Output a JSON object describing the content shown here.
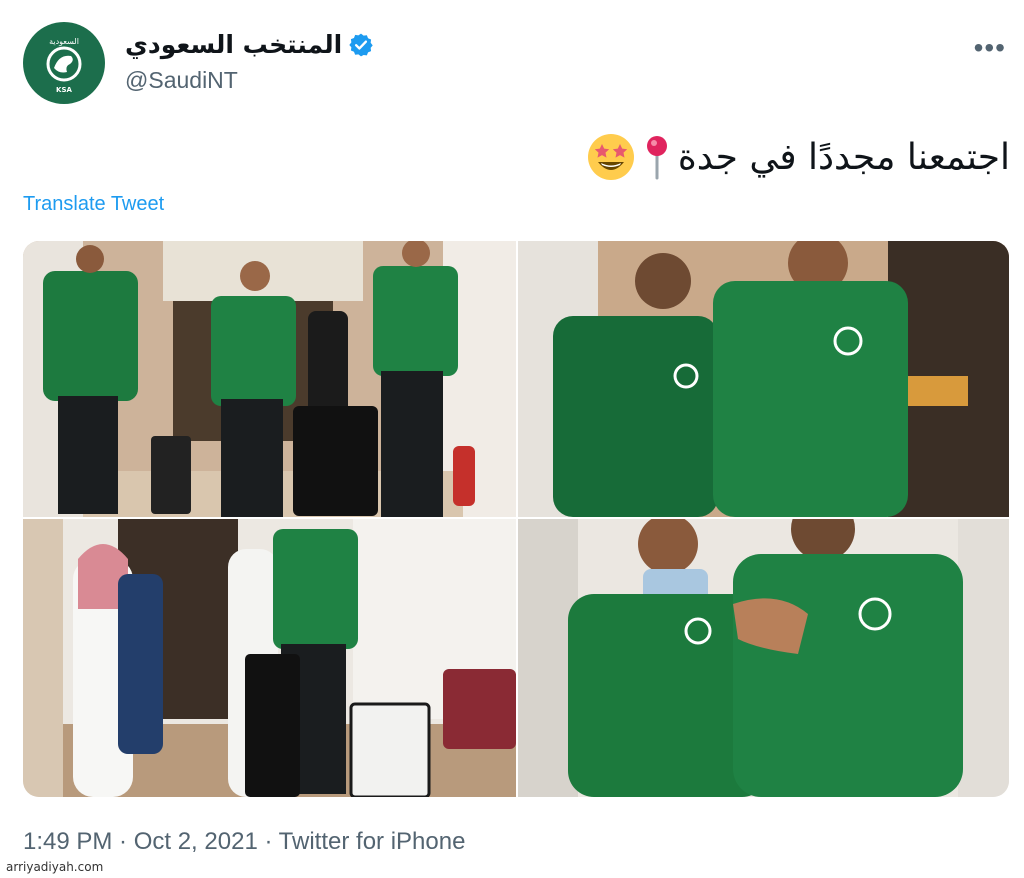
{
  "tweet": {
    "display_name": "المنتخب السعودي",
    "handle": "@SaudiNT",
    "avatar_top_text": "السعودية",
    "avatar_bottom_text": "KSA",
    "more_label": "•••",
    "text": "اجتمعنا مجددًا في جدة",
    "emojis": [
      "round-pushpin",
      "star-struck"
    ],
    "translate_label": "Translate Tweet",
    "timestamp": "1:49 PM · Oct 2, 2021 · Twitter for iPhone",
    "photo_count": 4,
    "colors": {
      "brand_green": "#1c6e4c",
      "link_blue": "#1d9bf0",
      "verified_blue": "#1d9bf0",
      "muted": "#536471"
    }
  },
  "watermark": "arriyadiyah.com"
}
